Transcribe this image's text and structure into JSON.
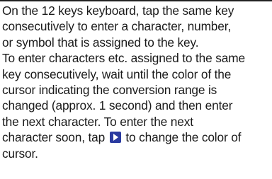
{
  "paragraph1": {
    "lines": [
      "On the 12 keys keyboard, tap the same key",
      "consecutively to enter a character, number,",
      "or symbol that is assigned to the key."
    ]
  },
  "paragraph2": {
    "lines": [
      "To enter characters etc. assigned to the same",
      "key consecutively, wait until the color of the",
      "cursor indicating the conversion range is",
      "changed (approx. 1 second) and then enter",
      "the next character. To enter the next"
    ],
    "line_with_icon_before": "character soon, tap",
    "line_with_icon_after": "to change the color of",
    "last_line": "cursor."
  },
  "icons": {
    "inline_key": "right-arrow-key-icon"
  },
  "colors": {
    "text": "#1a1a1a",
    "key_icon": "#2a3aa0"
  }
}
